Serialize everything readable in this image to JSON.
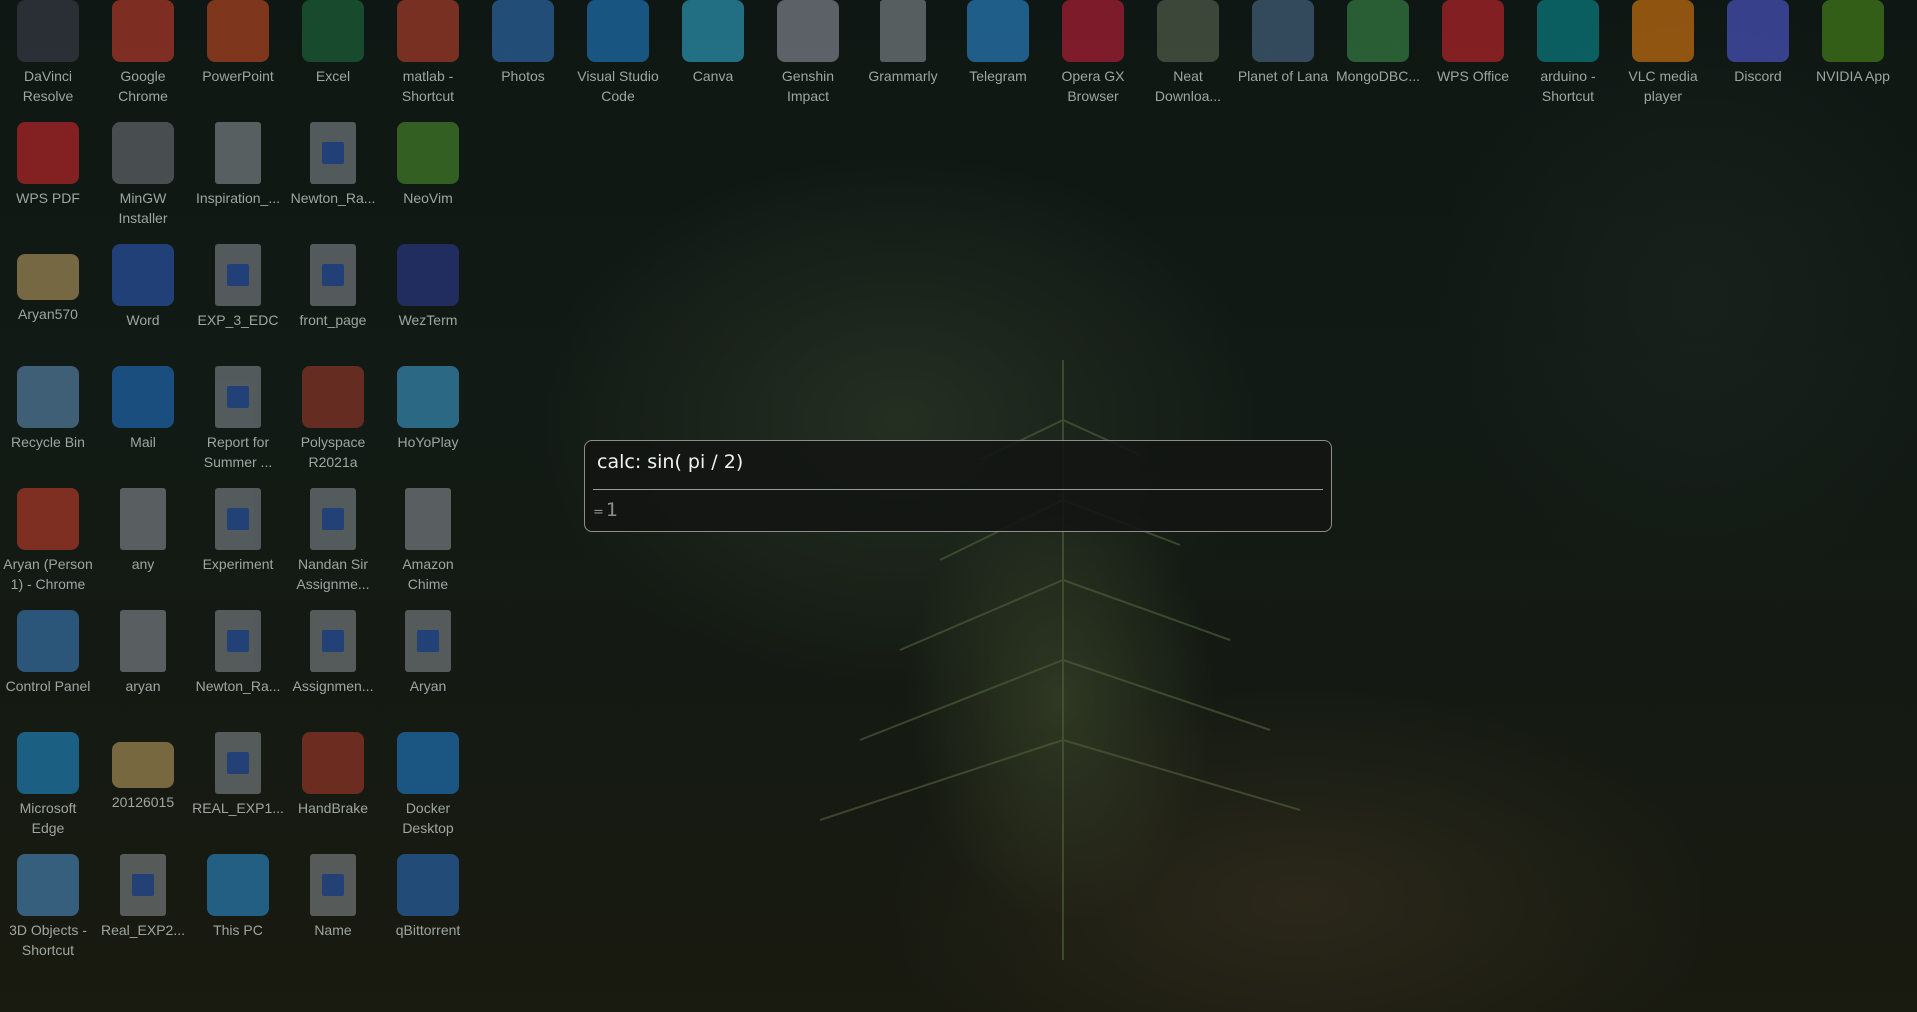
{
  "launcher": {
    "query": "calc: sin( pi / 2)",
    "result_prefix": "=",
    "result_value": "1"
  },
  "desktop_icons": [
    {
      "label": "DaVinci Resolve",
      "icon": "davinci-icon",
      "color": "#3a3f4a"
    },
    {
      "label": "Google Chrome",
      "icon": "chrome-icon",
      "color": "#c23b2c"
    },
    {
      "label": "PowerPoint",
      "icon": "powerpoint-icon",
      "color": "#c44a24"
    },
    {
      "label": "Excel",
      "icon": "excel-icon",
      "color": "#1e6b3f"
    },
    {
      "label": "matlab - Shortcut",
      "icon": "matlab-icon",
      "color": "#b8412a"
    },
    {
      "label": "Photos",
      "icon": "photos-icon",
      "color": "#2f6fb5"
    },
    {
      "label": "Visual Studio Code",
      "icon": "vscode-icon",
      "color": "#1f7cc4"
    },
    {
      "label": "Canva",
      "icon": "canva-icon",
      "color": "#2fa6c9"
    },
    {
      "label": "Genshin Impact",
      "icon": "genshin-icon",
      "color": "#8a8f9a"
    },
    {
      "label": "Grammarly",
      "icon": "document-icon",
      "color": "#8a8f94"
    },
    {
      "label": "Telegram",
      "icon": "telegram-icon",
      "color": "#2a8ad0"
    },
    {
      "label": "Opera GX Browser",
      "icon": "opera-icon",
      "color": "#c21e3a"
    },
    {
      "label": "Neat Downloa...",
      "icon": "neat-icon",
      "color": "#5b6650"
    },
    {
      "label": "Planet of Lana",
      "icon": "planet-of-lana-icon",
      "color": "#4a6a8a"
    },
    {
      "label": "MongoDBC...",
      "icon": "mongodb-icon",
      "color": "#3a8a4a"
    },
    {
      "label": "WPS Office",
      "icon": "wps-office-icon",
      "color": "#c8252c"
    },
    {
      "label": "arduino - Shortcut",
      "icon": "arduino-icon",
      "color": "#0a8a8f"
    },
    {
      "label": "VLC media player",
      "icon": "vlc-icon",
      "color": "#e07a10"
    },
    {
      "label": "Discord",
      "icon": "discord-icon",
      "color": "#4f5bd5"
    },
    {
      "label": "NVIDIA App",
      "icon": "nvidia-icon",
      "color": "#4a8a1c"
    },
    {
      "label": "WPS PDF",
      "icon": "wps-pdf-icon",
      "color": "#c8252c"
    },
    {
      "label": "MinGW Installer",
      "icon": "mingw-icon",
      "color": "#6a6f74"
    },
    {
      "label": "Inspiration_...",
      "icon": "document-icon",
      "color": "#8a8f94"
    },
    {
      "label": "Newton_Ra...",
      "icon": "word-document-icon",
      "color": "#2c59b4"
    },
    {
      "label": "NeoVim",
      "icon": "neovim-icon",
      "color": "#4a8a2c"
    },
    {
      "label": "Aryan570",
      "icon": "user-folder-icon",
      "color": "#b59a5e"
    },
    {
      "label": "Word",
      "icon": "word-icon",
      "color": "#2c59b4"
    },
    {
      "label": "EXP_3_EDC",
      "icon": "word-document-icon",
      "color": "#2c59b4"
    },
    {
      "label": "front_page",
      "icon": "word-document-icon",
      "color": "#2c59b4"
    },
    {
      "label": "WezTerm",
      "icon": "wezterm-icon",
      "color": "#2a3a8a"
    },
    {
      "label": "Recycle Bin",
      "icon": "recycle-bin-icon",
      "color": "#5a8ab0"
    },
    {
      "label": "Mail",
      "icon": "mail-icon",
      "color": "#1e6fc0"
    },
    {
      "label": "Report for Summer ...",
      "icon": "word-document-icon",
      "color": "#2c59b4"
    },
    {
      "label": "Polyspace R2021a",
      "icon": "polyspace-icon",
      "color": "#9a3a2a"
    },
    {
      "label": "HoYoPlay",
      "icon": "hoyoplay-icon",
      "color": "#3a9ac8"
    },
    {
      "label": "Aryan (Person 1) - Chrome",
      "icon": "chrome-profile-icon",
      "color": "#c23b2c"
    },
    {
      "label": "any",
      "icon": "text-document-icon",
      "color": "#8a8f94"
    },
    {
      "label": "Experiment",
      "icon": "word-document-icon",
      "color": "#2c59b4"
    },
    {
      "label": "Nandan Sir Assignme...",
      "icon": "word-document-icon",
      "color": "#2c59b4"
    },
    {
      "label": "Amazon Chime",
      "icon": "document-icon",
      "color": "#8a8f94"
    },
    {
      "label": "Control Panel",
      "icon": "control-panel-icon",
      "color": "#3a7ab8"
    },
    {
      "label": "aryan",
      "icon": "document-icon",
      "color": "#8a8f94"
    },
    {
      "label": "Newton_Ra...",
      "icon": "word-document-icon",
      "color": "#2c59b4"
    },
    {
      "label": "Assignmen...",
      "icon": "word-document-icon",
      "color": "#2c59b4"
    },
    {
      "label": "Aryan",
      "icon": "word-document-icon",
      "color": "#2c59b4"
    },
    {
      "label": "Microsoft Edge",
      "icon": "edge-icon",
      "color": "#1e8ac8"
    },
    {
      "label": "20126015",
      "icon": "folder-icon",
      "color": "#b59a5e"
    },
    {
      "label": "REAL_EXP1...",
      "icon": "word-document-icon",
      "color": "#2c59b4"
    },
    {
      "label": "HandBrake",
      "icon": "handbrake-icon",
      "color": "#a23a2a"
    },
    {
      "label": "Docker Desktop",
      "icon": "docker-icon",
      "color": "#1e7ac8"
    },
    {
      "label": "3D Objects - Shortcut",
      "icon": "3d-objects-icon",
      "color": "#4a8ac0"
    },
    {
      "label": "Real_EXP2...",
      "icon": "word-document-icon",
      "color": "#2c59b4"
    },
    {
      "label": "This PC",
      "icon": "this-pc-icon",
      "color": "#2a8ac8"
    },
    {
      "label": "Name",
      "icon": "word-document-icon",
      "color": "#2c59b4"
    },
    {
      "label": "qBittorrent",
      "icon": "qbittorrent-icon",
      "color": "#2a6ab8"
    }
  ]
}
